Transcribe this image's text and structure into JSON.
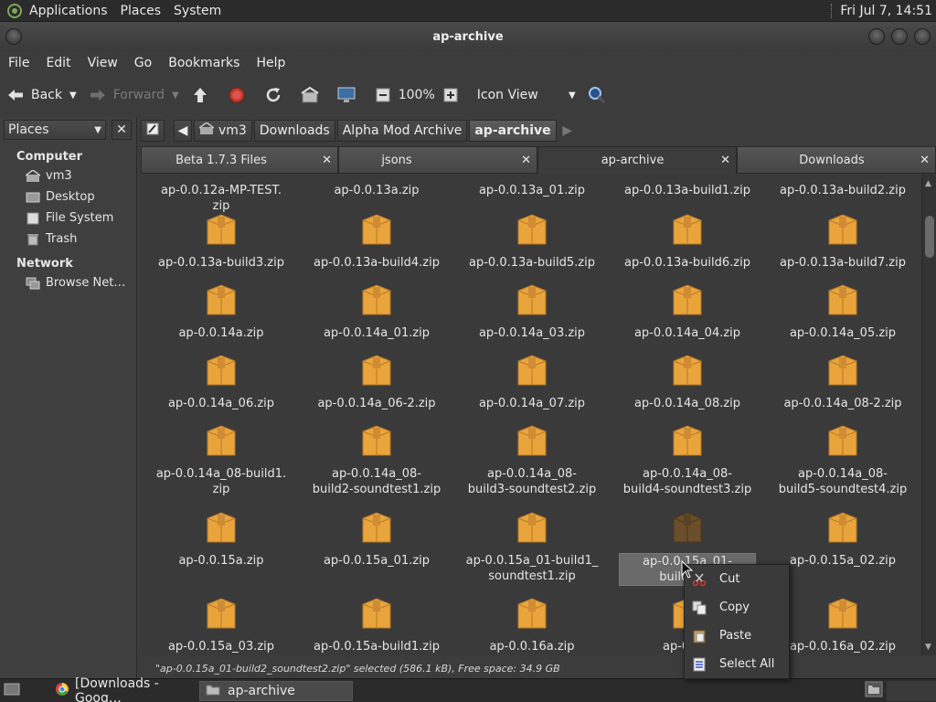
{
  "top_panel": {
    "menus": [
      "Applications",
      "Places",
      "System"
    ],
    "clock": "Fri Jul  7, 14:51"
  },
  "window": {
    "title": "ap-archive"
  },
  "menubar": [
    "File",
    "Edit",
    "View",
    "Go",
    "Bookmarks",
    "Help"
  ],
  "toolbar": {
    "back": "Back",
    "forward": "Forward",
    "zoom": "100%",
    "view_mode": "Icon View"
  },
  "sidebar": {
    "selector": "Places",
    "sections": [
      {
        "title": "Computer",
        "items": [
          {
            "label": "vm3",
            "icon": "home-folder-icon"
          },
          {
            "label": "Desktop",
            "icon": "desktop-icon"
          },
          {
            "label": "File System",
            "icon": "drive-icon"
          },
          {
            "label": "Trash",
            "icon": "trash-icon"
          }
        ]
      },
      {
        "title": "Network",
        "items": [
          {
            "label": "Browse Net…",
            "icon": "network-icon"
          }
        ]
      }
    ]
  },
  "breadcrumbs": [
    "vm3",
    "Downloads",
    "Alpha Mod Archive",
    "ap-archive"
  ],
  "tabs": [
    {
      "label": "Beta 1.7.3 Files",
      "active": false
    },
    {
      "label": "jsons",
      "active": false
    },
    {
      "label": "ap-archive",
      "active": true
    },
    {
      "label": "Downloads",
      "active": false
    }
  ],
  "files": [
    [
      "ap-0.0.12a-MP-TEST.\nzip",
      "ap-0.0.13a.zip",
      "ap-0.0.13a_01.zip",
      "ap-0.0.13a-build1.zip",
      "ap-0.0.13a-build2.zip"
    ],
    [
      "ap-0.0.13a-build3.zip",
      "ap-0.0.13a-build4.zip",
      "ap-0.0.13a-build5.zip",
      "ap-0.0.13a-build6.zip",
      "ap-0.0.13a-build7.zip"
    ],
    [
      "ap-0.0.14a.zip",
      "ap-0.0.14a_01.zip",
      "ap-0.0.14a_03.zip",
      "ap-0.0.14a_04.zip",
      "ap-0.0.14a_05.zip"
    ],
    [
      "ap-0.0.14a_06.zip",
      "ap-0.0.14a_06-2.zip",
      "ap-0.0.14a_07.zip",
      "ap-0.0.14a_08.zip",
      "ap-0.0.14a_08-2.zip"
    ],
    [
      "ap-0.0.14a_08-build1.\nzip",
      "ap-0.0.14a_08-\nbuild2-soundtest1.zip",
      "ap-0.0.14a_08-\nbuild3-soundtest2.zip",
      "ap-0.0.14a_08-\nbuild4-soundtest3.zip",
      "ap-0.0.14a_08-\nbuild5-soundtest4.zip"
    ],
    [
      "ap-0.0.15a.zip",
      "ap-0.0.15a_01.zip",
      "ap-0.0.15a_01-build1_\nsoundtest1.zip",
      "ap-0.0.15a_01-\nbuild2_so",
      "ap-0.0.15a_02.zip"
    ],
    [
      "ap-0.0.15a_03.zip",
      "ap-0.0.15a-build1.zip",
      "ap-0.0.16a.zip",
      "ap-0.0.1",
      "ap-0.0.16a_02.zip"
    ]
  ],
  "selected_file": "ap-0.0.15a_01-build2_soundtest2.zip",
  "status": "\"ap-0.0.15a_01-build2_soundtest2.zip\" selected (586.1 kB), Free space: 34.9 GB",
  "context_menu": [
    {
      "label": "Cut",
      "icon": "scissors-icon"
    },
    {
      "label": "Copy",
      "icon": "copy-icon"
    },
    {
      "label": "Paste",
      "icon": "paste-icon"
    },
    {
      "label": "Select All",
      "icon": "select-all-icon"
    }
  ],
  "taskbar": [
    {
      "label": "[Downloads - Goog…",
      "icon": "chrome-icon",
      "active": false
    },
    {
      "label": "ap-archive",
      "icon": "folder-icon",
      "active": true
    }
  ],
  "colors": {
    "accent": "#e9a53b",
    "zip_selected": "#6b4e2a"
  }
}
